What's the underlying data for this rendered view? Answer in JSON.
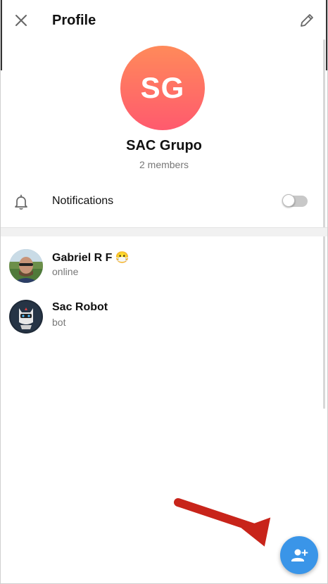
{
  "header": {
    "title": "Profile",
    "close_icon": "close-icon",
    "edit_icon": "pencil-icon"
  },
  "group": {
    "initials": "SG",
    "name": "SAC Grupo",
    "members_count": "2 members",
    "avatar_gradient": [
      "#ff8a5a",
      "#ff5a6e"
    ]
  },
  "notifications": {
    "label": "Notifications",
    "icon": "bell-icon",
    "enabled": false
  },
  "members": [
    {
      "name": "Gabriel R F 😷",
      "status": "online",
      "avatar": "photo-avatar"
    },
    {
      "name": "Sac Robot",
      "status": "bot",
      "avatar": "robot-avatar"
    }
  ],
  "fab": {
    "icon": "add-user-icon",
    "color": "#3a95e8"
  },
  "annotation": {
    "arrow_color": "#c8241a"
  }
}
